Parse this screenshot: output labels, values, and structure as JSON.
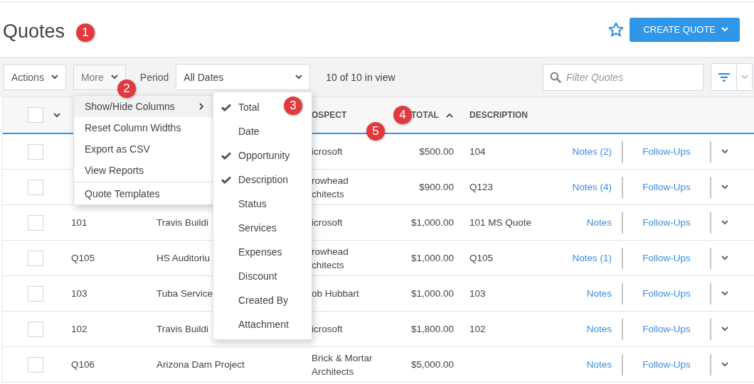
{
  "page": {
    "title": "Quotes",
    "starred": false,
    "create_button": "CREATE QUOTE"
  },
  "toolbar": {
    "actions": "Actions",
    "more": "More",
    "period_label": "Period",
    "period_value": "All Dates",
    "count": "10 of 10 in view",
    "search_placeholder": "Filter Quotes"
  },
  "table": {
    "header": {
      "all_checked": false,
      "prospect": "OSPECT",
      "total": "TOTAL",
      "total_sort_ascending": true,
      "description": "DESCRIPTION"
    },
    "rows": [
      {
        "checked": false,
        "prospect": "icrosoft",
        "total": "$500.00",
        "description": "104",
        "notes": "Notes (2)",
        "follow_ups": "Follow-Ups"
      },
      {
        "checked": false,
        "prospect": "rowhead\nchitects",
        "total": "$900.00",
        "description": "Q123",
        "notes": "Notes (4)",
        "follow_ups": "Follow-Ups"
      },
      {
        "checked": false,
        "number": "101",
        "opportunity": "Travis Buildi",
        "prospect": "icrosoft",
        "total": "$1,000.00",
        "description": "101 MS Quote",
        "notes": "Notes",
        "follow_ups": "Follow-Ups"
      },
      {
        "checked": false,
        "number": "Q105",
        "opportunity": "HS Auditoriu",
        "prospect": "rowhead\nchitects",
        "total": "$1,000.00",
        "description": "Q105",
        "notes": "Notes (1)",
        "follow_ups": "Follow-Ups"
      },
      {
        "checked": false,
        "number": "103",
        "opportunity": "Tuba Service",
        "prospect": "ob Hubbart",
        "total": "$1,000.00",
        "description": "103",
        "notes": "Notes",
        "follow_ups": "Follow-Ups"
      },
      {
        "checked": false,
        "number": "102",
        "opportunity": "Travis Buildi",
        "prospect": "icrosoft",
        "total": "$1,800.00",
        "description": "102",
        "notes": "Notes",
        "follow_ups": "Follow-Ups"
      },
      {
        "checked": false,
        "number": "Q106",
        "opportunity": "Arizona Dam Project",
        "prospect": "Brick & Mortar\nArchitects",
        "total": "$5,000.00",
        "notes": "Notes",
        "follow_ups": "Follow-Ups"
      }
    ]
  },
  "more_menu": {
    "items": [
      {
        "label": "Show/Hide Columns",
        "highlighted": true,
        "submenu": true
      },
      {
        "label": "Reset Column Widths",
        "highlighted": false
      },
      {
        "label": "Export as CSV",
        "highlighted": false
      },
      {
        "label": "View Reports",
        "highlighted": false
      },
      {
        "label": "Quote Templates",
        "highlighted": false,
        "separator_before": true
      }
    ]
  },
  "column_menu": {
    "items": [
      {
        "label": "Total",
        "checked": true
      },
      {
        "label": "Date",
        "checked": false
      },
      {
        "label": "Opportunity",
        "checked": true
      },
      {
        "label": "Description",
        "checked": true
      },
      {
        "label": "Status",
        "checked": false
      },
      {
        "label": "Services",
        "checked": false
      },
      {
        "label": "Expenses",
        "checked": false
      },
      {
        "label": "Discount",
        "checked": false
      },
      {
        "label": "Created By",
        "checked": false
      },
      {
        "label": "Attachment",
        "checked": false
      }
    ]
  },
  "markers": [
    "1",
    "2",
    "3",
    "4",
    "5"
  ]
}
